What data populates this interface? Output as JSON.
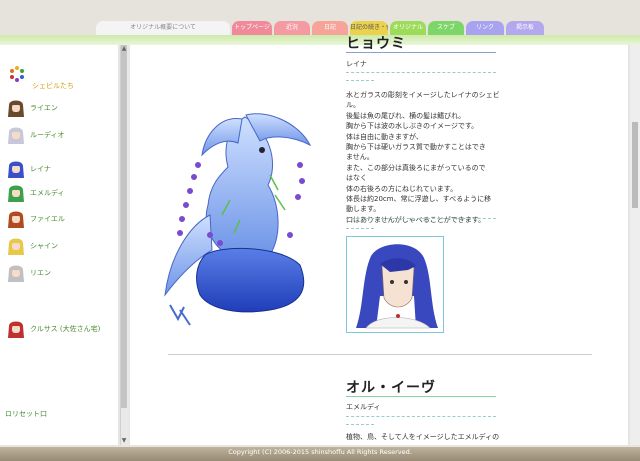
{
  "tabs": [
    {
      "label": "オリジナル概要について",
      "color": "#f4f4f4",
      "text": "#888"
    },
    {
      "label": "トップページ",
      "color": "#f08a9a",
      "text": "#fff"
    },
    {
      "label": "近況",
      "color": "#f59aa2",
      "text": "#fff"
    },
    {
      "label": "日記",
      "color": "#f6a39a",
      "text": "#fff"
    },
    {
      "label": "日記の続き・他",
      "color": "#ecd24a",
      "text": "#556"
    },
    {
      "label": "オリジナル",
      "color": "#9ddc5a",
      "text": "#fff"
    },
    {
      "label": "スケブ",
      "color": "#7ed66a",
      "text": "#fff"
    },
    {
      "label": "リンク",
      "color": "#a8a3f0",
      "text": "#fff"
    },
    {
      "label": "掲示板",
      "color": "#b3a7ee",
      "text": "#fff"
    }
  ],
  "sidebar": {
    "heading": "シェビルたち",
    "items": [
      {
        "label": "ライエン",
        "hair": "#6a4a2a"
      },
      {
        "label": "ルーディオ",
        "hair": "#c8c8d8"
      },
      {
        "label": "レイナ",
        "hair": "#3a50c8"
      },
      {
        "label": "エメルディ",
        "hair": "#3ea04a"
      },
      {
        "label": "ファイエル",
        "hair": "#b04a20"
      },
      {
        "label": "シャイン",
        "hair": "#e8c84a"
      },
      {
        "label": "リエン",
        "hair": "#c0c0c0"
      },
      {
        "label": "クルサス (大佐さん宅)",
        "hair": "#c03030"
      }
    ],
    "reset": "ロリセット口"
  },
  "entry1": {
    "title": "ヒョウミ",
    "owner": "レイナ",
    "lines": [
      "水とガラスの彫刻をイメージしたレイナのシェビ",
      "ル。",
      "後髪は魚の尾びれ、横の髪は鰭びれ。",
      "胸から下は波の水しぶきのイメージです。",
      "体は自由に動きますが、",
      "胸から下は硬いガラス質で動かすことはでき",
      "ません。",
      "また、この部分は真後ろにまがっているので",
      "はなく",
      "体の右後ろの方にねじれています。",
      "体長は約20cm、常に浮遊し、すべるように移",
      "動します。",
      "口はありませんがしゃべることができます。"
    ]
  },
  "entry2": {
    "title": "オル・イーヴ",
    "owner": "エメルディ",
    "first_line": "植物、鳥、そして人をイメージしたエメルディの"
  },
  "footer": "Copyright (C) 2006-2015 shinshoffu All Rights Reserved."
}
